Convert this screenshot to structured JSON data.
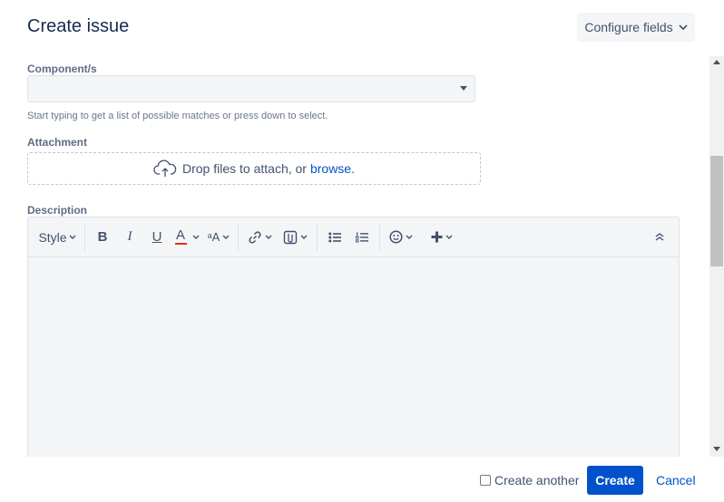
{
  "dialog": {
    "title": "Create issue",
    "configure_label": "Configure fields"
  },
  "fields": {
    "component": {
      "label": "Component/s",
      "value": "",
      "help": "Start typing to get a list of possible matches or press down to select."
    },
    "attachment": {
      "label": "Attachment",
      "drop_text": "Drop files to attach, or",
      "browse_label": "browse."
    },
    "description": {
      "label": "Description",
      "value": ""
    }
  },
  "toolbar": {
    "style_label": "Style",
    "bold": "B",
    "italic": "I",
    "underline": "U",
    "text_color": "A",
    "text_color_swatch": "#de350b",
    "text_effects": "ᵃA"
  },
  "footer": {
    "create_another_label": "Create another",
    "create_another_checked": false,
    "create_label": "Create",
    "cancel_label": "Cancel"
  },
  "colors": {
    "primary": "#0052cc",
    "link": "#0052cc",
    "text": "#172b4d",
    "subtle_bg": "#f4f5f7"
  }
}
